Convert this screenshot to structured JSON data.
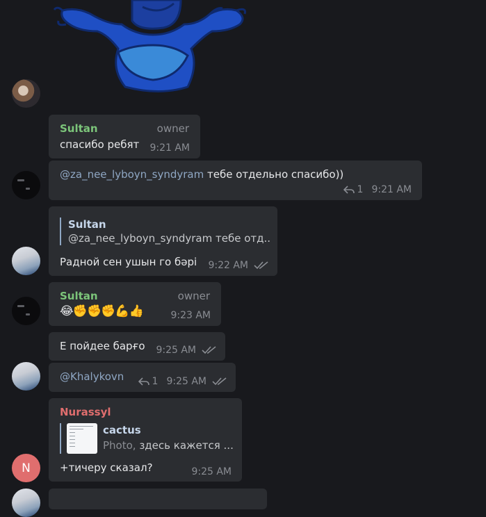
{
  "messages": {
    "m1": {
      "sender": "Sultan",
      "role": "owner",
      "text": "спасибо ребят",
      "time": "9:21 AM"
    },
    "m2": {
      "mention": "@za_nee_lyboyn_syndyram",
      "text": " тебе отдельно спасибо))",
      "replies": "1",
      "time": "9:21 AM"
    },
    "m3": {
      "quote_name": "Sultan",
      "quote_text": "@za_nee_lyboyn_syndyram тебе отд...",
      "text": "Радной сен ушын го бәрі",
      "time": "9:22 AM"
    },
    "m4": {
      "sender": "Sultan",
      "role": "owner",
      "text": "😂✊✊✊💪👍",
      "time": "9:23 AM"
    },
    "m5": {
      "text": "Е пойдее барғо",
      "time": "9:25 AM"
    },
    "m6": {
      "mention": "@Khalykovn",
      "replies": "1",
      "time": "9:25 AM"
    },
    "m7": {
      "sender": "Nurassyl",
      "quote_name": "cactus",
      "quote_kind": "Photo,",
      "quote_text": " здесь кажется ...",
      "text": "+тичеру сказал?",
      "time": "9:25 AM"
    }
  },
  "avatars": {
    "nurassyl_initial": "N"
  },
  "colors": {
    "background": "#18191d",
    "bubble": "#2b2d31",
    "green_name": "#7cc57a",
    "red_name": "#e06e6e",
    "link": "#8fa7c4"
  }
}
